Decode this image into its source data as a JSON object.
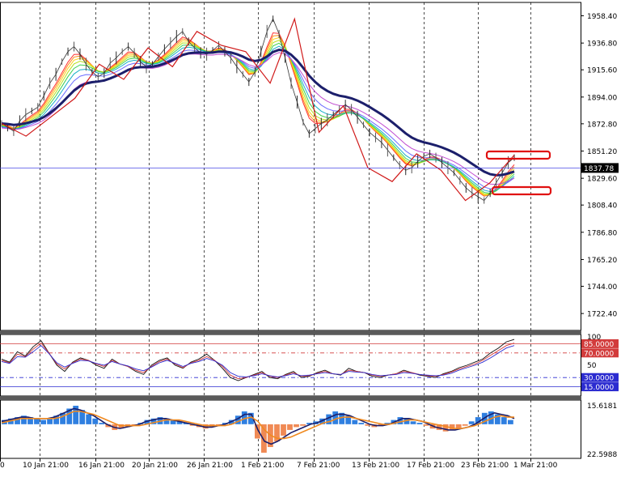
{
  "chart_data": [
    {
      "type": "line",
      "panel": "price",
      "description_labels": {
        "current_price": "1837.78"
      },
      "y_ticks": [
        "1958.40",
        "1936.80",
        "1915.60",
        "1894.00",
        "1872.80",
        "1851.20",
        "1829.60",
        "1808.40",
        "1786.80",
        "1765.20",
        "1744.00",
        "1722.40"
      ],
      "ylim": [
        1709,
        1969
      ],
      "x_labels": [
        "0",
        "10 Jan 21:00",
        "16 Jan 21:00",
        "20 Jan 21:00",
        "26 Jan 21:00",
        "1 Feb 21:00",
        "7 Feb 21:00",
        "13 Feb 21:00",
        "17 Feb 21:00",
        "23 Feb 21:00",
        "1 Mar 21:00"
      ],
      "current_price": 1837.78,
      "price_series": [
        1873,
        1870,
        1867,
        1875,
        1880,
        1883,
        1886,
        1895,
        1905,
        1912,
        1922,
        1930,
        1934,
        1928,
        1920,
        1914,
        1910,
        1913,
        1921,
        1925,
        1930,
        1934,
        1929,
        1922,
        1918,
        1920,
        1926,
        1932,
        1937,
        1942,
        1946,
        1938,
        1933,
        1929,
        1928,
        1931,
        1935,
        1930,
        1925,
        1918,
        1912,
        1906,
        1914,
        1930,
        1946,
        1956,
        1944,
        1925,
        1905,
        1890,
        1874,
        1865,
        1869,
        1873,
        1876,
        1880,
        1884,
        1888,
        1884,
        1878,
        1872,
        1866,
        1862,
        1858,
        1852,
        1846,
        1840,
        1836,
        1838,
        1843,
        1847,
        1849,
        1846,
        1842,
        1838,
        1834,
        1828,
        1822,
        1818,
        1815,
        1812,
        1818,
        1826,
        1834,
        1842,
        1846
      ],
      "ema_bundle_offsets": [
        0,
        -2,
        -4,
        -6,
        -8,
        -10,
        -12,
        -14
      ],
      "zigzag": [
        1873,
        1863,
        1878,
        1893,
        1920,
        1908,
        1933,
        1918,
        1946,
        1935,
        1930,
        1905,
        1956,
        1866,
        1887,
        1838,
        1827,
        1849,
        1836,
        1812,
        1826,
        1848
      ],
      "annotations": [
        "box-upper-1851",
        "box-lower-1829"
      ]
    },
    {
      "type": "line",
      "panel": "stochastic",
      "levels": [
        {
          "label": "85.0000",
          "value": 85,
          "color": "#d23b3b"
        },
        {
          "label": "70.0000",
          "value": 70,
          "color": "#d23b3b"
        },
        {
          "label": "30.0000",
          "value": 30,
          "color": "#2b2bd0"
        },
        {
          "label": "15.0000",
          "value": 15,
          "color": "#2b2bd0"
        }
      ],
      "top_label": "100",
      "mid_label": "50",
      "ylim": [
        0,
        100
      ],
      "series": [
        {
          "values": [
            60,
            55,
            72,
            65,
            80,
            90,
            70,
            50,
            40,
            55,
            62,
            58,
            50,
            45,
            60,
            52,
            48,
            40,
            35,
            50,
            58,
            62,
            50,
            45,
            55,
            60,
            68,
            58,
            45,
            30,
            25,
            30,
            35,
            40,
            30,
            28,
            35,
            40,
            30,
            32,
            38,
            42,
            36,
            34,
            45,
            40,
            38,
            32,
            30,
            34,
            36,
            42,
            38,
            34,
            32,
            30,
            36,
            40,
            46,
            50,
            55,
            60,
            70,
            78,
            88,
            92
          ]
        },
        {
          "values": [
            58,
            54,
            68,
            64,
            76,
            86,
            70,
            52,
            44,
            54,
            60,
            58,
            52,
            48,
            58,
            52,
            48,
            42,
            38,
            48,
            56,
            60,
            52,
            46,
            54,
            58,
            64,
            58,
            48,
            34,
            28,
            30,
            34,
            38,
            32,
            30,
            34,
            38,
            32,
            33,
            37,
            40,
            36,
            35,
            42,
            40,
            38,
            34,
            32,
            34,
            36,
            40,
            38,
            35,
            33,
            32,
            35,
            39,
            44,
            48,
            52,
            58,
            66,
            74,
            82,
            86
          ]
        },
        {
          "values": [
            56,
            53,
            64,
            63,
            72,
            82,
            69,
            54,
            47,
            53,
            58,
            57,
            53,
            50,
            56,
            52,
            49,
            44,
            41,
            47,
            54,
            58,
            53,
            48,
            53,
            56,
            61,
            57,
            50,
            38,
            32,
            31,
            33,
            36,
            33,
            31,
            33,
            36,
            33,
            34,
            36,
            38,
            36,
            35,
            40,
            39,
            38,
            35,
            33,
            34,
            35,
            38,
            37,
            35,
            34,
            33,
            34,
            37,
            42,
            46,
            50,
            55,
            62,
            70,
            78,
            82
          ]
        }
      ]
    },
    {
      "type": "bar",
      "panel": "macd",
      "top_label": "15.6181",
      "bottom_label": "22.5988",
      "ylim": [
        -24,
        17
      ],
      "values": [
        3,
        4,
        5,
        6,
        5,
        4,
        3,
        4,
        6,
        8,
        11,
        13,
        10,
        7,
        4,
        1,
        -2,
        -4,
        -3,
        -2,
        -1,
        1,
        3,
        4,
        5,
        4,
        3,
        2,
        1,
        -1,
        -2,
        -3,
        -2,
        -1,
        1,
        3,
        6,
        9,
        8,
        -10,
        -20,
        -16,
        -12,
        -8,
        -4,
        -2,
        -1,
        1,
        2,
        4,
        7,
        9,
        8,
        6,
        3,
        1,
        -1,
        -2,
        -1,
        1,
        3,
        5,
        4,
        2,
        1,
        -1,
        -3,
        -4,
        -5,
        -4,
        -3,
        -1,
        2,
        5,
        8,
        9,
        7,
        5,
        3
      ],
      "series": [
        {
          "values": [
            2,
            3,
            4,
            5,
            5,
            4,
            4,
            4,
            5,
            7,
            9,
            11,
            10,
            8,
            6,
            3,
            0,
            -2,
            -3,
            -2,
            -1,
            0,
            2,
            3,
            4,
            4,
            3,
            2,
            1,
            0,
            -1,
            -2,
            -2,
            -1,
            0,
            2,
            4,
            7,
            7,
            -4,
            -12,
            -14,
            -12,
            -9,
            -6,
            -4,
            -2,
            0,
            1,
            3,
            5,
            7,
            7,
            6,
            4,
            2,
            0,
            -1,
            -1,
            0,
            2,
            4,
            4,
            3,
            2,
            0,
            -2,
            -3,
            -4,
            -4,
            -3,
            -2,
            0,
            3,
            6,
            8,
            7,
            6,
            4
          ]
        },
        {
          "values": [
            1,
            2,
            3,
            4,
            4,
            4,
            4,
            4,
            4,
            5,
            7,
            9,
            9,
            8,
            7,
            5,
            3,
            1,
            -1,
            -1,
            -1,
            -1,
            0,
            1,
            2,
            3,
            3,
            3,
            2,
            1,
            0,
            -1,
            -1,
            -1,
            -1,
            0,
            2,
            4,
            5,
            2,
            -4,
            -8,
            -10,
            -10,
            -9,
            -7,
            -5,
            -3,
            -1,
            1,
            2,
            4,
            5,
            5,
            4,
            3,
            2,
            1,
            0,
            0,
            1,
            2,
            3,
            3,
            2,
            1,
            0,
            -1,
            -2,
            -3,
            -3,
            -2,
            -1,
            1,
            3,
            5,
            6,
            5,
            5
          ]
        }
      ]
    }
  ]
}
